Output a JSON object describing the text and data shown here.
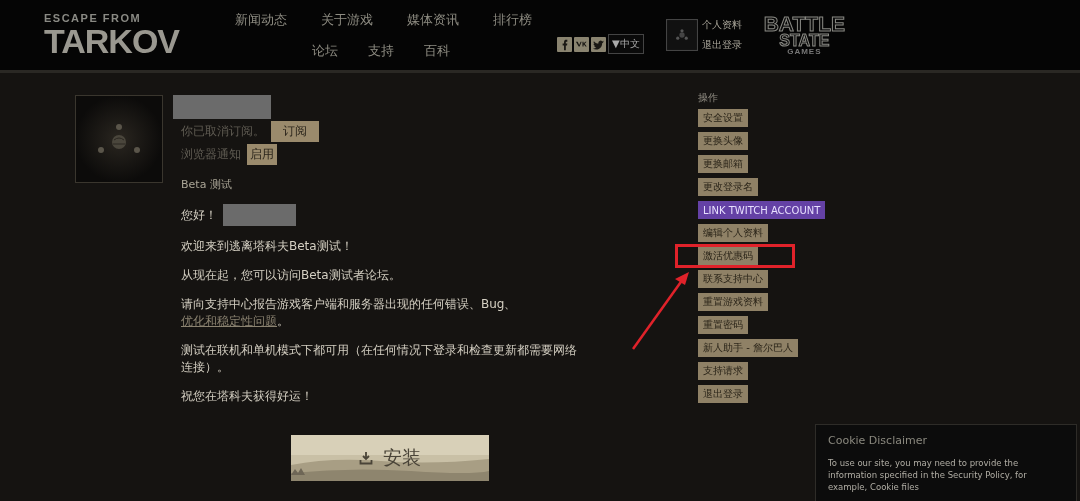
{
  "header": {
    "logo": {
      "top": "ESCAPE FROM",
      "main": "TARKOV"
    },
    "nav_row_1": [
      "新闻动态",
      "关于游戏",
      "媒体资讯",
      "排行榜"
    ],
    "nav_row_2": [
      "论坛",
      "支持",
      "百科"
    ],
    "language": "▼中文",
    "user_links": [
      "个人资料",
      "退出登录"
    ],
    "studio_logo": {
      "main": "BATTLE",
      "sub": "STATE",
      "small": "GAMES"
    }
  },
  "profile": {
    "subscription_text": "你已取消订阅。",
    "subscribe_button": "订阅",
    "notification_text": "浏览器通知",
    "enable_button": "启用",
    "section_title": "Beta 测试",
    "greeting": "您好！",
    "paragraphs": [
      {
        "text": "欢迎来到逃离塔科夫Beta测试！"
      },
      {
        "text": "从现在起，您可以访问Beta测试者论坛。"
      },
      {
        "text": "请向支持中心报告游戏客户端和服务器出现的任何错误、Bug、",
        "link": "优化和稳定性问题",
        "after": "。"
      },
      {
        "text": "测试在联机和单机模式下都可用（在任何情况下登录和检查更新都需要网络连接）。"
      },
      {
        "text": "祝您在塔科夫获得好运！"
      }
    ],
    "install_button": "安装"
  },
  "actions": {
    "title": "操作",
    "items": [
      {
        "label": "安全设置",
        "kind": "normal",
        "highlighted": false
      },
      {
        "label": "更换头像",
        "kind": "normal",
        "highlighted": false
      },
      {
        "label": "更换邮箱",
        "kind": "normal",
        "highlighted": false
      },
      {
        "label": "更改登录名",
        "kind": "normal",
        "highlighted": false
      },
      {
        "label": "LINK TWITCH ACCOUNT",
        "kind": "twitch",
        "highlighted": false
      },
      {
        "label": "编辑个人资料",
        "kind": "normal",
        "highlighted": false
      },
      {
        "label": "激活优惠码",
        "kind": "normal",
        "highlighted": true
      },
      {
        "label": "联系支持中心",
        "kind": "normal",
        "highlighted": false
      },
      {
        "label": "重置游戏资料",
        "kind": "normal",
        "highlighted": false
      },
      {
        "label": "重置密码",
        "kind": "normal",
        "highlighted": false
      },
      {
        "label": "新人助手 - 詹尔巴人",
        "kind": "normal",
        "highlighted": false
      },
      {
        "label": "支持请求",
        "kind": "normal",
        "highlighted": false
      },
      {
        "label": "退出登录",
        "kind": "normal",
        "highlighted": false
      }
    ]
  },
  "cookie": {
    "title": "Cookie Disclaimer",
    "text": "To use our site, you may need to provide the information specified in the Security Policy, for example, Cookie files"
  }
}
